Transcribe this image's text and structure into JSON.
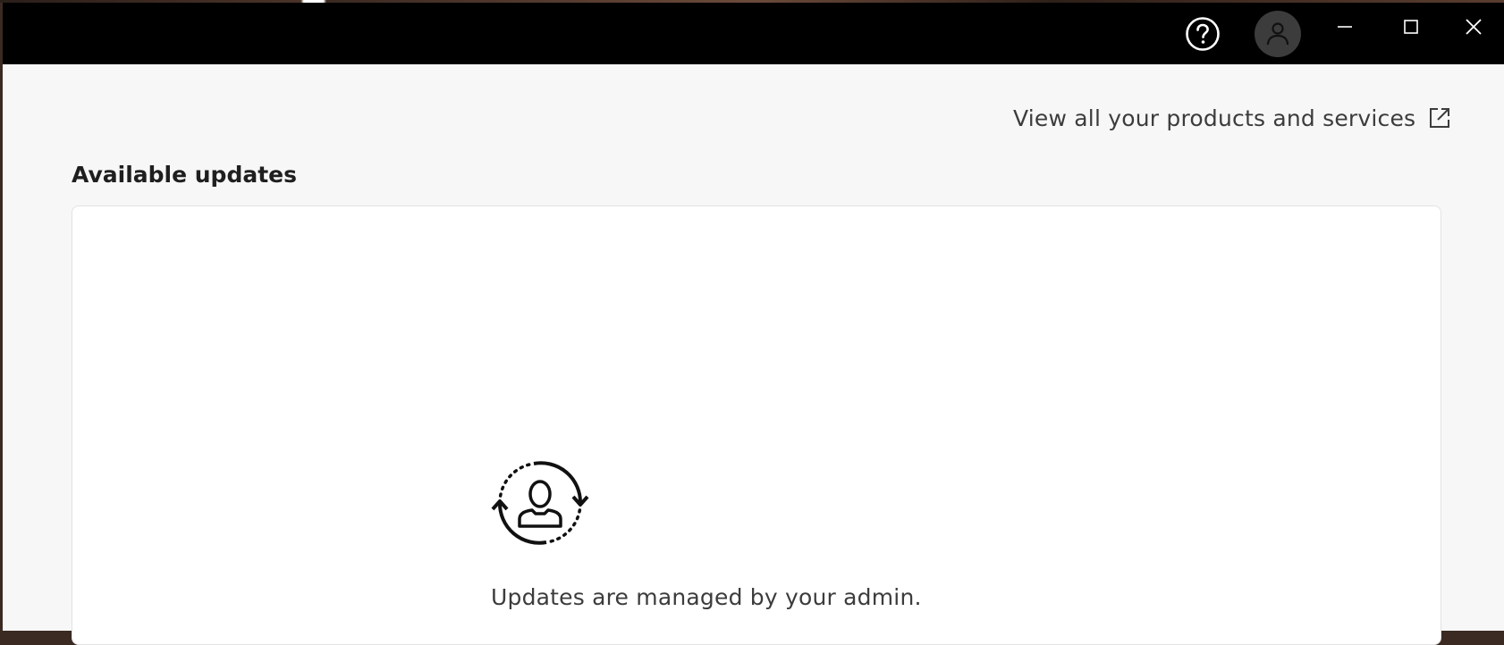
{
  "titlebar": {
    "help_icon": "help-circle-icon",
    "avatar_icon": "user-avatar-icon",
    "minimize_icon": "minimize-icon",
    "maximize_icon": "maximize-icon",
    "close_icon": "close-icon"
  },
  "header": {
    "products_link_label": "View all your products and services",
    "products_link_icon": "external-link-icon"
  },
  "updates": {
    "title": "Available updates",
    "empty_icon": "admin-sync-icon",
    "empty_message": "Updates are managed by your admin."
  },
  "colors": {
    "titlebar_bg": "#000000",
    "page_bg": "#f7f7f7",
    "card_bg": "#ffffff",
    "avatar_bg": "#3c3c3c"
  }
}
